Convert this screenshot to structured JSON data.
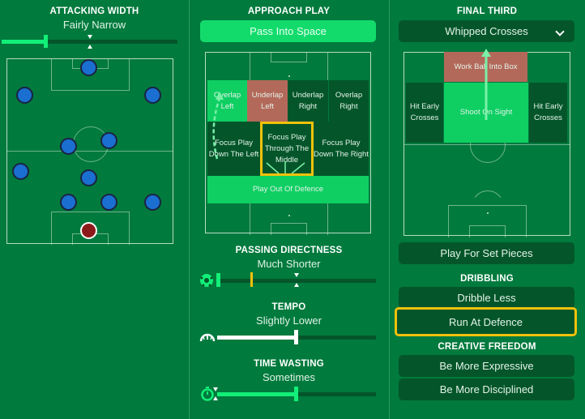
{
  "attacking_width": {
    "heading": "ATTACKING WIDTH",
    "value": "Fairly Narrow",
    "slider_fraction": 0.25
  },
  "formation": {
    "players_icon": "player-marker",
    "goalkeeper_icon": "goalkeeper-marker"
  },
  "approach_play": {
    "heading": "APPROACH PLAY",
    "selected": "Pass Into Space",
    "zones": {
      "overlap_left": "Overlap Left",
      "underlap_left": "Underlap Left",
      "underlap_right": "Underlap Right",
      "overlap_right": "Overlap Right",
      "focus_left": "Focus Play Down The Left",
      "focus_middle": "Focus Play Through The Middle",
      "focus_right": "Focus Play Down The Right",
      "play_out": "Play Out Of Defence"
    }
  },
  "passing_directness": {
    "heading": "PASSING DIRECTNESS",
    "value": "Much Shorter",
    "slider_fraction": 0.2,
    "icon": "football-icon"
  },
  "tempo": {
    "heading": "TEMPO",
    "value": "Slightly Lower",
    "slider_fraction": 0.5,
    "icon": "speedometer-icon"
  },
  "time_wasting": {
    "heading": "TIME WASTING",
    "value": "Sometimes",
    "slider_fraction": 0.5,
    "icon": "stopwatch-icon"
  },
  "final_third": {
    "heading": "FINAL THIRD",
    "dropdown_value": "Whipped Crosses",
    "zones": {
      "work_ball": "Work Ball Into Box",
      "hit_early_left": "Hit Early Crosses",
      "shoot_on_sight": "Shoot On Sight",
      "hit_early_right": "Hit Early Crosses"
    },
    "set_pieces": "Play For Set Pieces"
  },
  "dribbling": {
    "heading": "DRIBBLING",
    "options": [
      "Dribble Less",
      "Run At Defence"
    ],
    "selected": "Run At Defence"
  },
  "creative_freedom": {
    "heading": "CREATIVE FREEDOM",
    "options": [
      "Be More Expressive",
      "Be More Disciplined"
    ]
  },
  "colors": {
    "background": "#007a3d",
    "accent_green": "#12db6c",
    "dark_green": "#04562a",
    "highlight_yellow": "#f2c10b",
    "zone_red": "#b3695a",
    "player_blue": "#1a6fd1",
    "goalkeeper_red": "#8d1a1a"
  }
}
